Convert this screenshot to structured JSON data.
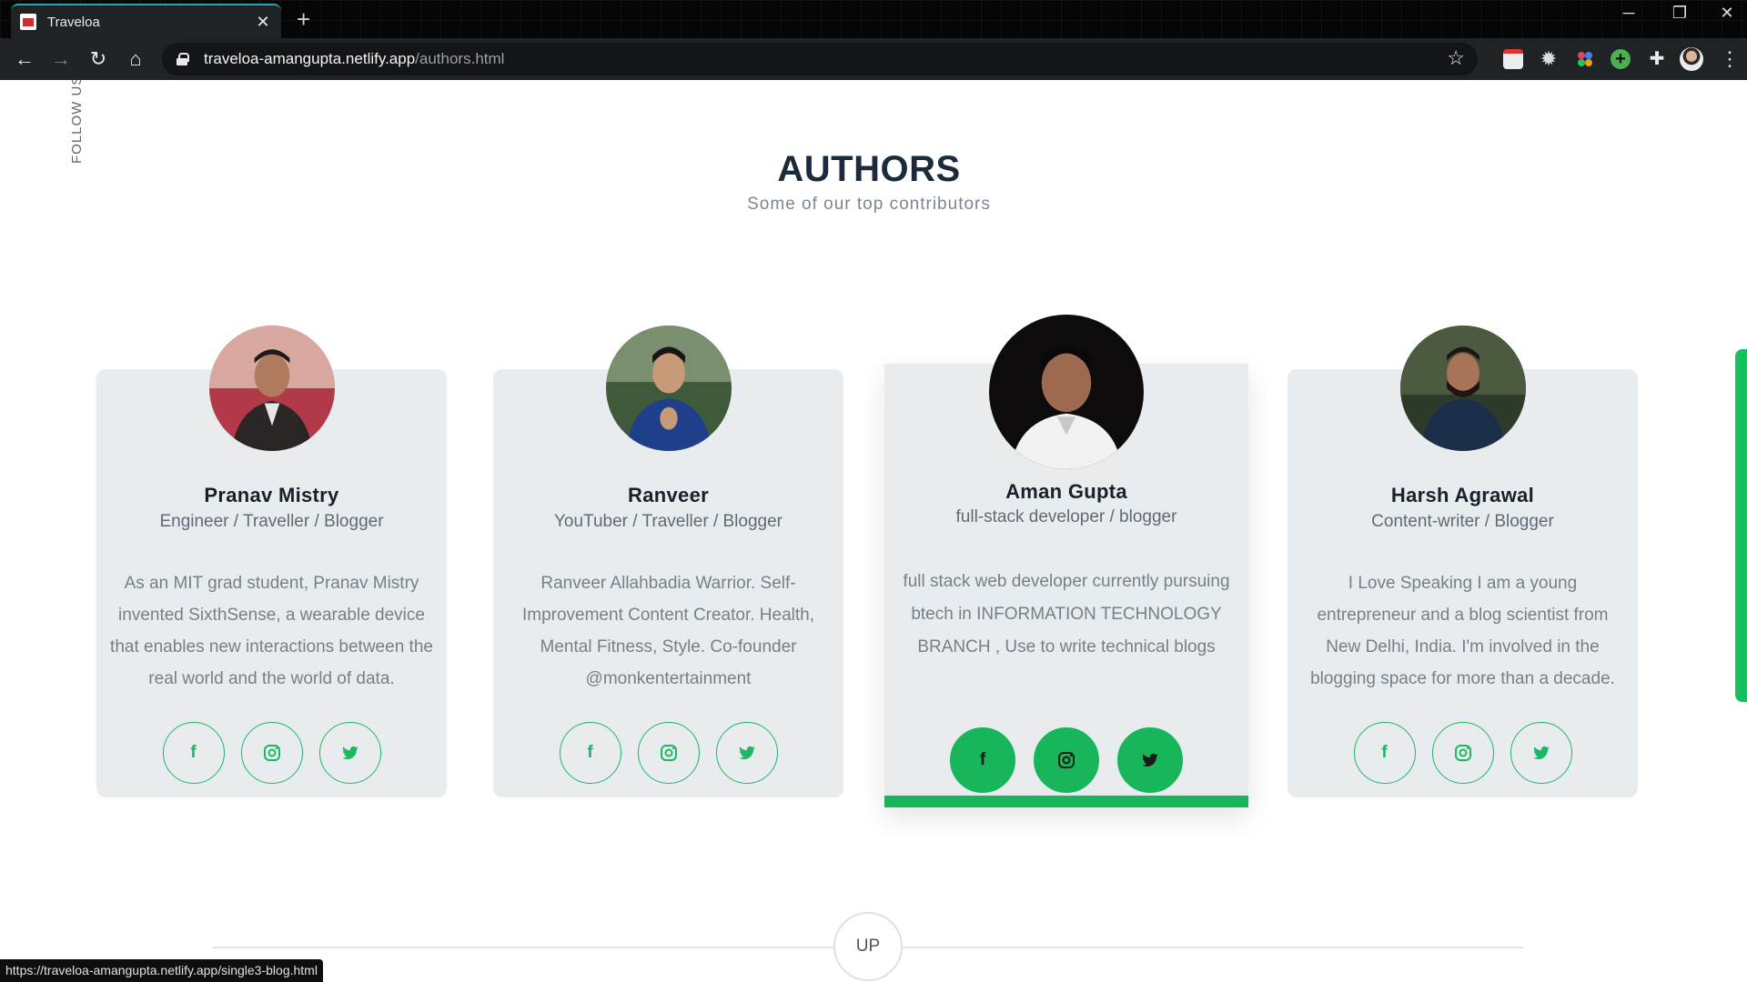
{
  "browser": {
    "tab_title": "Traveloa",
    "tab_close": "✕",
    "new_tab": "+",
    "url_host": "traveloa-amangupta.netlify.app",
    "url_path": "/authors.html",
    "status_url": "https://traveloa-amangupta.netlify.app/single3-blog.html"
  },
  "page": {
    "follow_us": "FOLLOW US",
    "title": "AUTHORS",
    "subtitle": "Some of our top contributors",
    "up_label": "UP"
  },
  "authors": [
    {
      "name": "Pranav Mistry",
      "role": "Engineer / Traveller / Blogger",
      "bio": "As an MIT grad student, Pranav Mistry invented SixthSense, a wearable device that enables new interactions between the real world and the world of data."
    },
    {
      "name": "Ranveer",
      "role": "YouTuber / Traveller / Blogger",
      "bio": "Ranveer Allahbadia Warrior. Self-Improvement Content Creator. Health, Mental Fitness, Style. Co-founder @monkentertainment"
    },
    {
      "name": "Aman Gupta",
      "role": "full-stack developer / blogger",
      "bio": "full stack web developer currently pursuing btech in INFORMATION TECHNOLOGY BRANCH , Use to write technical blogs"
    },
    {
      "name": "Harsh Agrawal",
      "role": "Content-writer / Blogger",
      "bio": "I Love Speaking I am a young entrepreneur and a blog scientist from New Delhi, India. I'm involved in the blogging space for more than a decade."
    }
  ],
  "social_icons": [
    "facebook-icon",
    "instagram-icon",
    "twitter-icon"
  ],
  "colors": {
    "accent": "#18b65a",
    "card_bg": "#e9ecef",
    "title": "#1c2b3b"
  }
}
